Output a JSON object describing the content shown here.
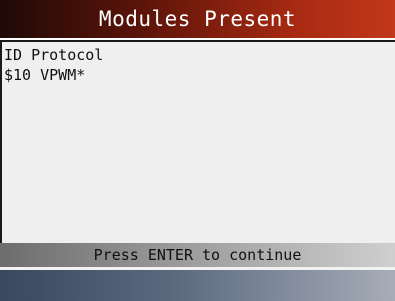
{
  "screen": {
    "title": "Modules Present",
    "lines": [
      "ID Protocol",
      "$10 VPWM*"
    ],
    "prompt": "Press ENTER to continue"
  },
  "colors": {
    "title_bg_dark": "#1f0a07",
    "title_bg_bright": "#c2381a",
    "content_bg": "#efefef",
    "prompt_bg_dark": "#6d6d6d",
    "prompt_bg_light": "#cfcfcf",
    "footer_bg_dark": "#39475f",
    "footer_bg_light": "#a7adb8"
  }
}
